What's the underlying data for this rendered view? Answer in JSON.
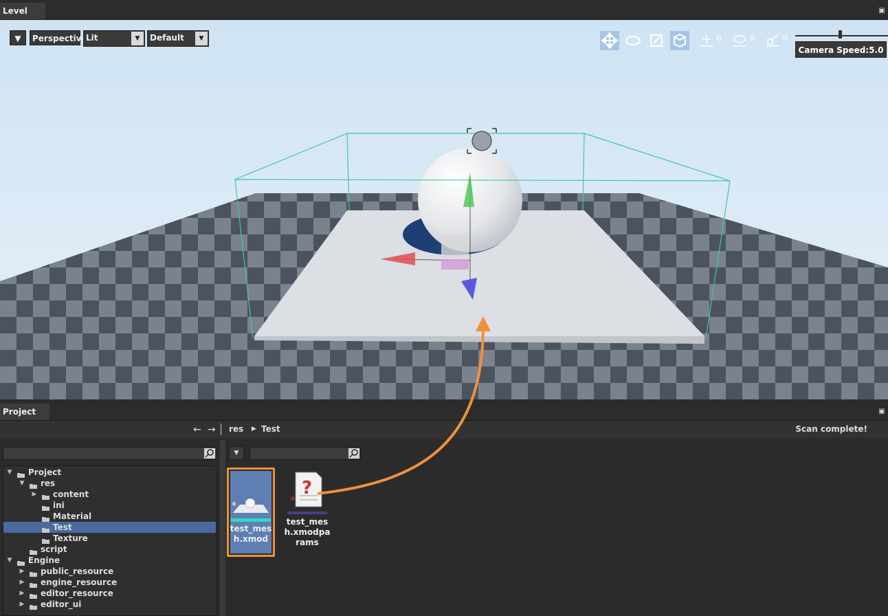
{
  "level_panel": {
    "tab_label": "Level",
    "perspective_label": "Perspective",
    "shading_mode": "Lit",
    "profile": "Default",
    "tool_counts": {
      "translate": "0",
      "rotate": "0",
      "scale": "0"
    },
    "camera_speed_label": "Camera Speed:5.0"
  },
  "project_panel": {
    "tab_label": "Project",
    "breadcrumb": [
      "res",
      "Test"
    ],
    "status": "Scan complete!",
    "tree": [
      {
        "label": "Project",
        "depth": 0,
        "expanded": true
      },
      {
        "label": "res",
        "depth": 1,
        "expanded": true
      },
      {
        "label": "content",
        "depth": 2,
        "expandable": true
      },
      {
        "label": "ini",
        "depth": 2
      },
      {
        "label": "Material",
        "depth": 2
      },
      {
        "label": "Test",
        "depth": 2,
        "selected": true
      },
      {
        "label": "Texture",
        "depth": 2
      },
      {
        "label": "script",
        "depth": 1
      },
      {
        "label": "Engine",
        "depth": 0,
        "expanded": true
      },
      {
        "label": "public_resource",
        "depth": 1,
        "expandable": true
      },
      {
        "label": "engine_resource",
        "depth": 1,
        "expandable": true
      },
      {
        "label": "editor_resource",
        "depth": 1,
        "expandable": true
      },
      {
        "label": "editor_ui",
        "depth": 1,
        "expandable": true
      }
    ],
    "assets": [
      {
        "name": "test_mesh.xmod",
        "selected": true,
        "bar_color": "#35d8c0"
      },
      {
        "name": "test_mesh.xmodparams",
        "selected": false,
        "bar_color": "#4a3f8a"
      }
    ]
  },
  "colors": {
    "accent_highlight": "#f0913a",
    "selection_blue": "#4a6aa0",
    "bounding_box": "#3fc9a0"
  }
}
